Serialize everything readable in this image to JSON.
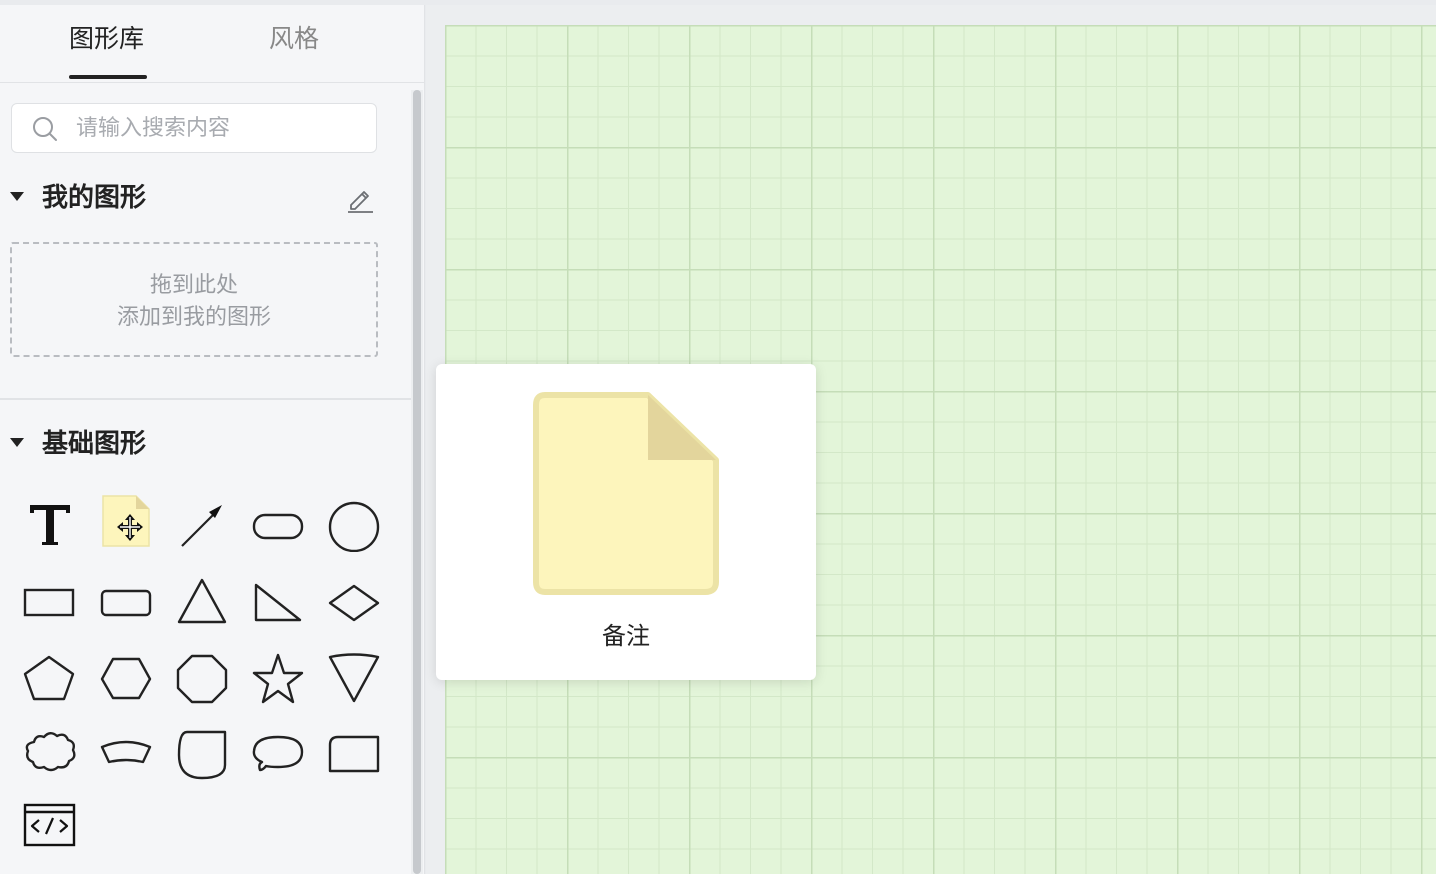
{
  "tabs": {
    "shapes_label": "图形库",
    "style_label": "风格"
  },
  "search": {
    "placeholder": "请输入搜索内容"
  },
  "my_shapes": {
    "title": "我的图形",
    "dropzone_line1": "拖到此处",
    "dropzone_line2": "添加到我的图形"
  },
  "basic_shapes": {
    "title": "基础图形",
    "items": [
      "text",
      "note",
      "arrow-line",
      "rounded-pill",
      "circle",
      "rectangle",
      "rounded-rectangle",
      "triangle",
      "right-triangle",
      "diamond",
      "pentagon",
      "hexagon",
      "octagon",
      "star",
      "inverted-triangle",
      "cloud",
      "curved-banner",
      "half-rounded-square",
      "speech-bubble",
      "tab-rectangle",
      "code-block"
    ]
  },
  "preview": {
    "label": "备注"
  },
  "colors": {
    "note_fill": "#fdf5bc",
    "note_border": "#ece3a6",
    "note_fold": "#e3d59c",
    "canvas_bg": "#e3f5d9",
    "canvas_grid": "#c5ddb8"
  }
}
